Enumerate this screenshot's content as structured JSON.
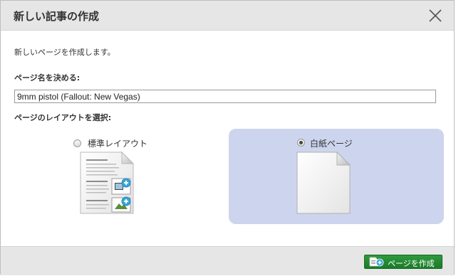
{
  "dialog": {
    "title": "新しい記事の作成",
    "intro": "新しいページを作成します。",
    "name_label": "ページ名を決める:",
    "name_value": "9mm pistol (Fallout: New Vegas)",
    "layout_label": "ページのレイアウトを選択:",
    "options": [
      {
        "label": "標準レイアウト",
        "selected": false
      },
      {
        "label": "白紙ページ",
        "selected": true
      }
    ],
    "create_button": "ページを作成"
  },
  "colors": {
    "header_bg": "#e6e6e6",
    "selected_option_bg": "#cdd5ee",
    "button_green": "#1f8a31",
    "plus_badge": "#38a7d8"
  },
  "icons": [
    "close-icon",
    "standard-layout-page-icon",
    "blank-page-icon",
    "add-page-icon"
  ]
}
